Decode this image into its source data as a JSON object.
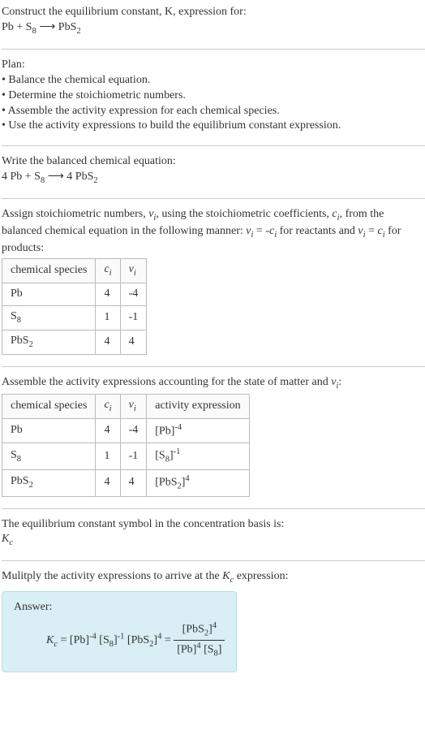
{
  "intro": {
    "line1": "Construct the equilibrium constant, K, expression for:",
    "reaction_unbalanced_html": "Pb + S<sub>8</sub> ⟶ PbS<sub>2</sub>"
  },
  "plan": {
    "heading": "Plan:",
    "items": [
      "Balance the chemical equation.",
      "Determine the stoichiometric numbers.",
      "Assemble the activity expression for each chemical species.",
      "Use the activity expressions to build the equilibrium constant expression."
    ]
  },
  "balanced": {
    "heading": "Write the balanced chemical equation:",
    "reaction_html": "4 Pb + S<sub>8</sub> ⟶ 4 PbS<sub>2</sub>"
  },
  "assign": {
    "text_html": "Assign stoichiometric numbers, <span class=\"italic\">ν<sub>i</sub></span>, using the stoichiometric coefficients, <span class=\"italic\">c<sub>i</sub></span>, from the balanced chemical equation in the following manner: <span class=\"italic\">ν<sub>i</sub></span> = -<span class=\"italic\">c<sub>i</sub></span> for reactants and <span class=\"italic\">ν<sub>i</sub></span> = <span class=\"italic\">c<sub>i</sub></span> for products:",
    "table": {
      "headers": [
        "chemical species",
        "c_i",
        "ν_i"
      ],
      "rows": [
        {
          "species_html": "Pb",
          "c": "4",
          "nu": "-4"
        },
        {
          "species_html": "S<sub>8</sub>",
          "c": "1",
          "nu": "-1"
        },
        {
          "species_html": "PbS<sub>2</sub>",
          "c": "4",
          "nu": "4"
        }
      ]
    }
  },
  "activity": {
    "text_html": "Assemble the activity expressions accounting for the state of matter and <span class=\"italic\">ν<sub>i</sub></span>:",
    "table": {
      "headers": [
        "chemical species",
        "c_i",
        "ν_i",
        "activity expression"
      ],
      "rows": [
        {
          "species_html": "Pb",
          "c": "4",
          "nu": "-4",
          "act_html": "[Pb]<sup>-4</sup>"
        },
        {
          "species_html": "S<sub>8</sub>",
          "c": "1",
          "nu": "-1",
          "act_html": "[S<sub>8</sub>]<sup>-1</sup>"
        },
        {
          "species_html": "PbS<sub>2</sub>",
          "c": "4",
          "nu": "4",
          "act_html": "[PbS<sub>2</sub>]<sup>4</sup>"
        }
      ]
    }
  },
  "symbol": {
    "line1": "The equilibrium constant symbol in the concentration basis is:",
    "sym_html": "<span class=\"italic\">K<sub>c</sub></span>"
  },
  "final": {
    "heading_html": "Mulitply the activity expressions to arrive at the <span class=\"italic\">K<sub>c</sub></span> expression:",
    "answer_label": "Answer:",
    "lhs_html": "<span class=\"italic\">K<sub>c</sub></span> = [Pb]<sup>-4</sup> [S<sub>8</sub>]<sup>-1</sup> [PbS<sub>2</sub>]<sup>4</sup> = ",
    "frac_num_html": "[PbS<sub>2</sub>]<sup>4</sup>",
    "frac_den_html": "[Pb]<sup>4</sup> [S<sub>8</sub>]"
  },
  "chart_data": {
    "type": "table",
    "title": "Stoichiometric and activity data for Pb + S8 → PbS2",
    "stoichiometric_table": {
      "columns": [
        "chemical species",
        "c_i",
        "nu_i"
      ],
      "rows": [
        [
          "Pb",
          4,
          -4
        ],
        [
          "S8",
          1,
          -1
        ],
        [
          "PbS2",
          4,
          4
        ]
      ]
    },
    "activity_table": {
      "columns": [
        "chemical species",
        "c_i",
        "nu_i",
        "activity expression"
      ],
      "rows": [
        [
          "Pb",
          4,
          -4,
          "[Pb]^-4"
        ],
        [
          "S8",
          1,
          -1,
          "[S8]^-1"
        ],
        [
          "PbS2",
          4,
          4,
          "[PbS2]^4"
        ]
      ]
    },
    "balanced_equation": "4 Pb + S8 -> 4 PbS2",
    "Kc_expression": "Kc = [PbS2]^4 / ([Pb]^4 [S8])"
  }
}
